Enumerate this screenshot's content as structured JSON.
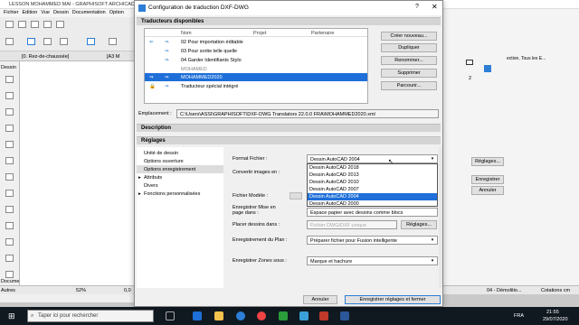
{
  "app": {
    "title": "LESSON MOHAMMED MAI - GRAPHISOFT ARCHICAD",
    "menu": [
      "Fichier",
      "Edition",
      "Vue",
      "Dessin",
      "Documentation",
      "Option"
    ],
    "tab_floor": "[0. Rez-de-chaussée]",
    "tab_a3": "[A3 M",
    "left_panel_label": "Dessin",
    "status_zoom": "52%",
    "status_val": "0,0",
    "bottom_left_1": "Docume",
    "bottom_left_2": "Autres",
    "right_tab": "ection, Tous les E...",
    "right_num": "2",
    "right_btn_reglages": "Réglages...",
    "right_btn_enregistrer": "Enregistrer",
    "right_btn_annuler": "Annuler",
    "status_right_1": "04 - Démolitio...",
    "status_right_2": "Cotations cm"
  },
  "dialog": {
    "title": "Configuration de traduction DXF-DWG",
    "help_glyph": "?",
    "close_glyph": "✕",
    "section_translators": "Traducteurs disponibles",
    "list_headers": {
      "nom": "Nom",
      "projet": "Projet",
      "partenaire": "Partenaire"
    },
    "translators": [
      {
        "name": "02 Pour importation éditable",
        "left": "⇐",
        "right": "⇒"
      },
      {
        "name": "03 Pour sortie telle quelle",
        "left": "",
        "right": "⇒"
      },
      {
        "name": "04 Garder Identifiants Stylo",
        "left": "",
        "right": "⇒"
      },
      {
        "name": "MOHAMED",
        "left": "",
        "right": ""
      },
      {
        "name": "MOHAMMED2020",
        "left": "⇒",
        "right": "⇒"
      },
      {
        "name": "Traducteur spécial intégré",
        "left": "🔒",
        "right": "⇒"
      }
    ],
    "buttons": {
      "new": "Créer nouveau...",
      "duplicate": "Dupliquer",
      "rename": "Renommer...",
      "delete": "Supprimer",
      "browse": "Parcourir..."
    },
    "location_label": "Emplacement :",
    "location_value": "C:\\Users\\ASSI\\GRAPHISOFT\\DXF-DWG Translators 22.0.0 FRA\\MOHAMMED2020.xml",
    "section_description": "Description",
    "section_settings": "Réglages",
    "settings_nav": [
      {
        "label": "Unité de dessin",
        "prefix": ""
      },
      {
        "label": "Options ouverture",
        "prefix": ""
      },
      {
        "label": "Options enregistrement",
        "prefix": ""
      },
      {
        "label": "Attributs",
        "prefix": "▸"
      },
      {
        "label": "Divers",
        "prefix": ""
      },
      {
        "label": "Fonctions personnalisées",
        "prefix": "▸"
      }
    ],
    "format_label": "Format Fichier :",
    "format_value": "Dessin AutoCAD 2004",
    "format_options": [
      "Dessin AutoCAD 2018",
      "Dessin AutoCAD 2013",
      "Dessin AutoCAD 2010",
      "Dessin AutoCAD 2007",
      "Dessin AutoCAD 2004",
      "Dessin AutoCAD 2000"
    ],
    "convert_label": "Convertir images en :",
    "model_file_label": "Fichier Modèle :",
    "layout_label": "Enregistrer Mise en page dans :",
    "layout_value": "Espace papier avec dessins comme blocs",
    "place_label": "Placer dessins dans :",
    "place_value": "Fichier DWG/DXF unique",
    "place_button": "Réglages...",
    "plan_label": "Enregistrement du Plan :",
    "plan_value": "Préparer fichier pour Fusion intelligente",
    "zones_label": "Enregistrer Zones sous :",
    "zones_value": "Marque et hachure",
    "cancel": "Annuler",
    "save_close": "Enregistrer réglages et fermer"
  },
  "taskbar": {
    "search_placeholder": "Taper ici pour rechercher",
    "time": "21:55",
    "date": "29/07/2020",
    "lang": "FRA"
  }
}
